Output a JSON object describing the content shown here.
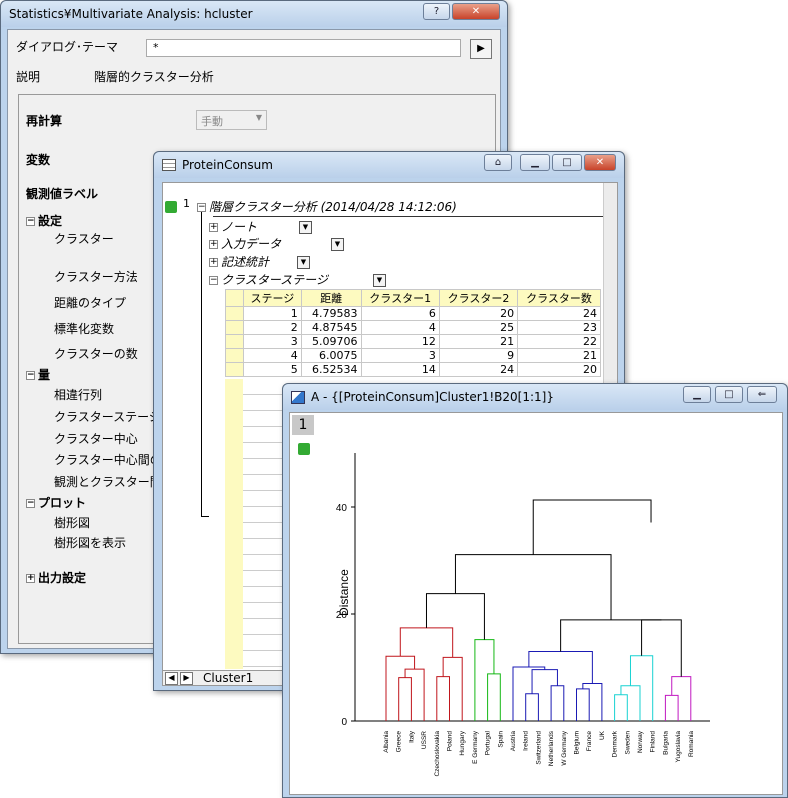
{
  "dialog": {
    "title": "Statistics¥Multivariate Analysis: hcluster",
    "theme_label": "ダイアログ･テーマ",
    "theme_value": "*",
    "desc_label": "説明",
    "desc_value": "階層的クラスター分析",
    "recalc_label": "再計算",
    "recalc_value": "手動",
    "vars_label": "変数",
    "obs_label": "観測値ラベル",
    "settings_label": "設定",
    "cluster_label": "クラスター",
    "method_label": "クラスター方法",
    "distance_label": "距離のタイプ",
    "std_label": "標準化変数",
    "num_label": "クラスターの数",
    "quantity_label": "量",
    "q_items": [
      "相違行列",
      "クラスターステージ",
      "クラスター中心",
      "クラスター中心間の",
      "観測とクラスター間の"
    ],
    "plot_label": "プロット",
    "p_items": [
      "樹形図",
      "樹形図を表示"
    ],
    "output_label": "出力設定"
  },
  "workbook": {
    "title": "ProteinConsum",
    "tree_root": "階層クラスター分析 (2014/04/28 14:12:06)",
    "row_num": "1",
    "nodes": [
      "ノート",
      "入力データ",
      "記述統計",
      "クラスターステージ"
    ],
    "columns": [
      "ステージ",
      "距離",
      "クラスター1",
      "クラスター2",
      "クラスター数"
    ],
    "rows": [
      [
        "1",
        "4.79583",
        "6",
        "20",
        "24"
      ],
      [
        "2",
        "4.87545",
        "4",
        "25",
        "23"
      ],
      [
        "3",
        "5.09706",
        "12",
        "21",
        "22"
      ],
      [
        "4",
        "6.0075",
        "3",
        "9",
        "21"
      ],
      [
        "5",
        "6.52534",
        "14",
        "24",
        "20"
      ]
    ],
    "sheet_tab": "Cluster1"
  },
  "graph": {
    "title": "A - {[ProteinConsum]Cluster1!B20[1:1]}",
    "layer": "1"
  },
  "chart_data": {
    "type": "dendrogram",
    "ylabel": "Distance",
    "yticks": [
      "0",
      "20",
      "40"
    ],
    "ylim": [
      0,
      46
    ],
    "leaves": [
      "Albania",
      "Greece",
      "Italy",
      "USSR",
      "Czechoslovakia",
      "Poland",
      "Hungary",
      "E Germany",
      "Portugal",
      "Spain",
      "Austria",
      "Ireland",
      "Switzerland",
      "Netherlands",
      "W Germany",
      "Belgium",
      "France",
      "UK",
      "Denmark",
      "Sweden",
      "Norway",
      "Finland",
      "Bulgaria",
      "Yugoslavia",
      "Romania"
    ],
    "colors": {
      "red": "#c0161c",
      "green": "#14b814",
      "blue": "#1a1ab4",
      "cyan": "#18d2d2",
      "magenta": "#c018c0",
      "black": "#000000"
    },
    "merges": [
      {
        "l": 1,
        "r": 2,
        "h": 8.1,
        "c": "red"
      },
      {
        "l": "m0",
        "r": 3,
        "h": 9.7,
        "c": "red"
      },
      {
        "l": 0,
        "r": "m1",
        "h": 12.1,
        "c": "red"
      },
      {
        "l": 4,
        "r": 5,
        "h": 8.3,
        "c": "red"
      },
      {
        "l": "m3",
        "r": 6,
        "h": 11.9,
        "c": "red"
      },
      {
        "l": "m2",
        "r": "m4",
        "h": 17.4,
        "c": "red"
      },
      {
        "l": 8,
        "r": 9,
        "h": 8.8,
        "c": "green"
      },
      {
        "l": 7,
        "r": "m6",
        "h": 15.2,
        "c": "green"
      },
      {
        "l": "m5",
        "r": "m7",
        "h": 23.8,
        "c": "black"
      },
      {
        "l": 11,
        "r": 12,
        "h": 5.1,
        "c": "blue"
      },
      {
        "l": 13,
        "r": 14,
        "h": 6.6,
        "c": "blue"
      },
      {
        "l": "m9",
        "r": "m10",
        "h": 9.6,
        "c": "blue"
      },
      {
        "l": 10,
        "r": "m11",
        "h": 10.1,
        "c": "blue"
      },
      {
        "l": 15,
        "r": 16,
        "h": 6.0,
        "c": "blue"
      },
      {
        "l": "m13",
        "r": 17,
        "h": 7.0,
        "c": "blue"
      },
      {
        "l": "m12",
        "r": "m14",
        "h": 13.0,
        "c": "blue"
      },
      {
        "l": 18,
        "r": 19,
        "h": 4.9,
        "c": "cyan"
      },
      {
        "l": "m16",
        "r": 20,
        "h": 6.6,
        "c": "cyan"
      },
      {
        "l": "m17",
        "r": 21,
        "h": 12.2,
        "c": "cyan"
      },
      {
        "l": 22,
        "r": 23,
        "h": 4.8,
        "c": "magenta"
      },
      {
        "l": "m19",
        "r": 24,
        "h": 8.3,
        "c": "magenta"
      },
      {
        "l": "m18",
        "r": "m20",
        "h": 18.9,
        "c": "black"
      },
      {
        "l": "m15",
        "r": "m21",
        "h": 18.9,
        "c": "black"
      },
      {
        "l": "m8",
        "r": "m22",
        "h": 31.1,
        "c": "black"
      },
      {
        "l": "m23",
        "r": "m22",
        "h": 41.3,
        "c": "black",
        "skip": true
      }
    ]
  }
}
